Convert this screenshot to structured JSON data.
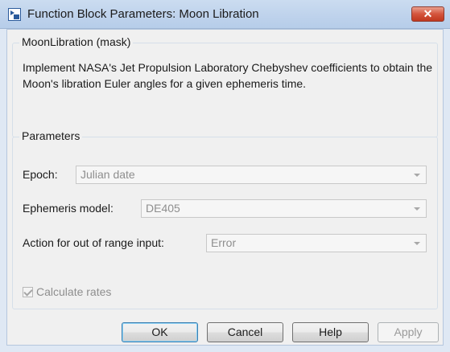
{
  "window": {
    "title": "Function Block Parameters: Moon Libration",
    "close_glyph": "✕"
  },
  "mask": {
    "legend": "MoonLibration (mask)",
    "description": "Implement NASA's Jet Propulsion Laboratory Chebyshev coefficients to obtain the Moon's libration Euler angles for a given ephemeris time."
  },
  "parameters": {
    "legend": "Parameters",
    "epoch": {
      "label": "Epoch:",
      "value": "Julian date"
    },
    "ephemeris_model": {
      "label": "Ephemeris model:",
      "value": "DE405"
    },
    "action_out_of_range": {
      "label": "Action for out of range input:",
      "value": "Error"
    },
    "calculate_rates": {
      "label": "Calculate rates",
      "checked": true,
      "enabled": false
    }
  },
  "buttons": {
    "ok": "OK",
    "cancel": "Cancel",
    "help": "Help",
    "apply": "Apply"
  },
  "colors": {
    "titlebar": "#bfd3ec",
    "close_button": "#d4543c",
    "dialog_bg": "#f0f0f0",
    "disabled_text": "#8e8e8e"
  }
}
